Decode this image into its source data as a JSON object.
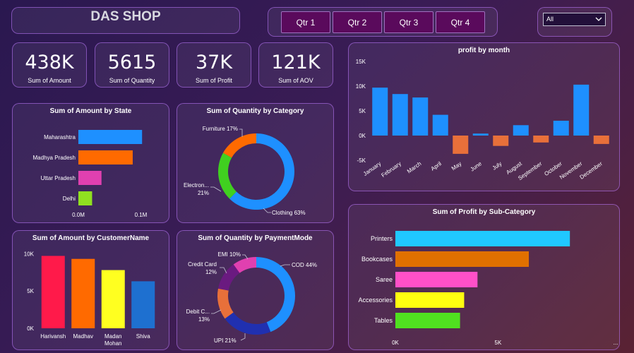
{
  "header": {
    "title": "DAS SHOP"
  },
  "quarters": [
    "Qtr 1",
    "Qtr 2",
    "Qtr 3",
    "Qtr 4"
  ],
  "filter": {
    "selected": "All"
  },
  "kpis": [
    {
      "value": "438K",
      "label": "Sum of Amount"
    },
    {
      "value": "5615",
      "label": "Sum of Quantity"
    },
    {
      "value": "37K",
      "label": "Sum of Profit"
    },
    {
      "value": "121K",
      "label": "Sum of AOV"
    }
  ],
  "colors": {
    "accent_border": "#be78ff",
    "blue": "#1e90ff",
    "orange": "#ff6a00",
    "pink": "#e040b0",
    "green": "#90e020"
  },
  "chart_data": [
    {
      "id": "state",
      "type": "bar",
      "orientation": "horizontal",
      "title": "Sum of Amount by State",
      "categories": [
        "Maharashtra",
        "Madhya Pradesh",
        "Uttar Pradesh",
        "Delhi"
      ],
      "values": [
        0.102,
        0.087,
        0.037,
        0.022
      ],
      "colors": [
        "#1e90ff",
        "#ff6a00",
        "#e040b0",
        "#90e020"
      ],
      "xlim": [
        0,
        0.13
      ],
      "xticks": [
        {
          "v": 0,
          "label": "0.0M"
        },
        {
          "v": 0.1,
          "label": "0.1M"
        }
      ]
    },
    {
      "id": "category",
      "type": "pie",
      "donut": true,
      "title": "Sum of Quantity by Category",
      "slices": [
        {
          "name": "Clothing",
          "value": 63,
          "label": "Clothing 63%",
          "color": "#1e90ff"
        },
        {
          "name": "Electronics",
          "value": 21,
          "label": "Electron... 21%",
          "color": "#40d020"
        },
        {
          "name": "Furniture",
          "value": 17,
          "label": "Furniture 17%",
          "color": "#ff6a00"
        }
      ]
    },
    {
      "id": "month",
      "type": "bar",
      "title": "profit by month",
      "categories": [
        "January",
        "February",
        "March",
        "April",
        "May",
        "June",
        "July",
        "August",
        "September",
        "October",
        "November",
        "December"
      ],
      "values": [
        9700,
        8400,
        7700,
        4200,
        -3700,
        400,
        -2100,
        2100,
        -1400,
        3000,
        10300,
        -1700
      ],
      "ylim": [
        -5000,
        15000
      ],
      "yticks": [
        {
          "v": 15000,
          "label": "15K"
        },
        {
          "v": 10000,
          "label": "10K"
        },
        {
          "v": 5000,
          "label": "5K"
        },
        {
          "v": 0,
          "label": "0K"
        },
        {
          "v": -5000,
          "label": "-5K"
        }
      ],
      "positive_color": "#1e90ff",
      "negative_color": "#e8703a"
    },
    {
      "id": "customer",
      "type": "bar",
      "title": "Sum of Amount by CustomerName",
      "categories": [
        "Harivansh",
        "Madhav",
        "Madan Mohan",
        "Shiva"
      ],
      "values": [
        9700,
        9300,
        7800,
        6300
      ],
      "colors": [
        "#ff1a4a",
        "#ff6a00",
        "#ffff20",
        "#1e70d0"
      ],
      "ylim": [
        0,
        10500
      ],
      "yticks": [
        {
          "v": 10000,
          "label": "10K"
        },
        {
          "v": 5000,
          "label": "5K"
        },
        {
          "v": 0,
          "label": "0K"
        }
      ]
    },
    {
      "id": "payment",
      "type": "pie",
      "donut": true,
      "title": "Sum of Quantity by PaymentMode",
      "slices": [
        {
          "name": "COD",
          "value": 44,
          "label": "COD 44%",
          "color": "#1e90ff"
        },
        {
          "name": "UPI",
          "value": 21,
          "label": "UPI 21%",
          "color": "#2030b0"
        },
        {
          "name": "Debit Card",
          "value": 13,
          "label": "Debit C... 13%",
          "color": "#e8703a"
        },
        {
          "name": "Credit Card",
          "value": 12,
          "label": "Credit Card 12%",
          "color": "#6a1a80"
        },
        {
          "name": "EMI",
          "value": 10,
          "label": "EMI 10%",
          "color": "#e040b0"
        }
      ]
    },
    {
      "id": "subcat",
      "type": "bar",
      "orientation": "horizontal",
      "title": "Sum of Profit by Sub-Category",
      "categories": [
        "Printers",
        "Bookcases",
        "Saree",
        "Accessories",
        "Tables"
      ],
      "values": [
        8500,
        6500,
        4000,
        3350,
        3150
      ],
      "colors": [
        "#20c8ff",
        "#e07000",
        "#ff50c8",
        "#ffff10",
        "#50e020"
      ],
      "xlim": [
        0,
        9800
      ],
      "xticks": [
        {
          "v": 0,
          "label": "0K"
        },
        {
          "v": 5000,
          "label": "5K"
        }
      ],
      "overflow_label": "..."
    }
  ]
}
